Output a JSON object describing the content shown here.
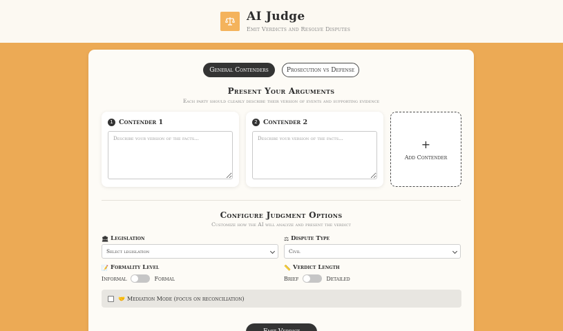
{
  "header": {
    "title": "AI Judge",
    "subtitle": "Emit Verdicts and Resolve Disputes",
    "logo_icon": "scales-icon"
  },
  "tabs": [
    {
      "label": "General Contenders",
      "active": true
    },
    {
      "label": "Prosecution vs Defense",
      "active": false
    }
  ],
  "arguments": {
    "title": "Present Your Arguments",
    "subtitle": "Each party should clearly describe their version of events and supporting evidence",
    "contenders": [
      {
        "number": "1",
        "title": "Contender 1",
        "placeholder": "Describe your version of the facts..."
      },
      {
        "number": "2",
        "title": "Contender 2",
        "placeholder": "Describe your version of the facts..."
      }
    ],
    "add_label": "Add Contender",
    "add_symbol": "+"
  },
  "options": {
    "title": "Configure Judgment Options",
    "subtitle": "Customize how the AI will analyze and present the verdict",
    "legislation": {
      "label": "Legislation",
      "icon": "🏛",
      "value": "Select legislation"
    },
    "dispute_type": {
      "label": "Dispute Type",
      "icon": "⚖",
      "value": "Civil"
    },
    "formality": {
      "label": "Formality Level",
      "icon": "📝",
      "left": "Informal",
      "right": "Formal",
      "on": false
    },
    "verdict_length": {
      "label": "Verdict Length",
      "icon": "📏",
      "left": "Brief",
      "right": "Detailed",
      "on": false
    },
    "mediation": {
      "icon": "🤝",
      "label": "Mediation Mode (focus on reconciliation)",
      "checked": false
    }
  },
  "submit_label": "Emit Verdict",
  "colors": {
    "background": "#ecaa55",
    "header_bg": "#fcf9f2",
    "card_bg": "#fdfbf6",
    "accent": "#f4b35c",
    "dark": "#343434"
  }
}
